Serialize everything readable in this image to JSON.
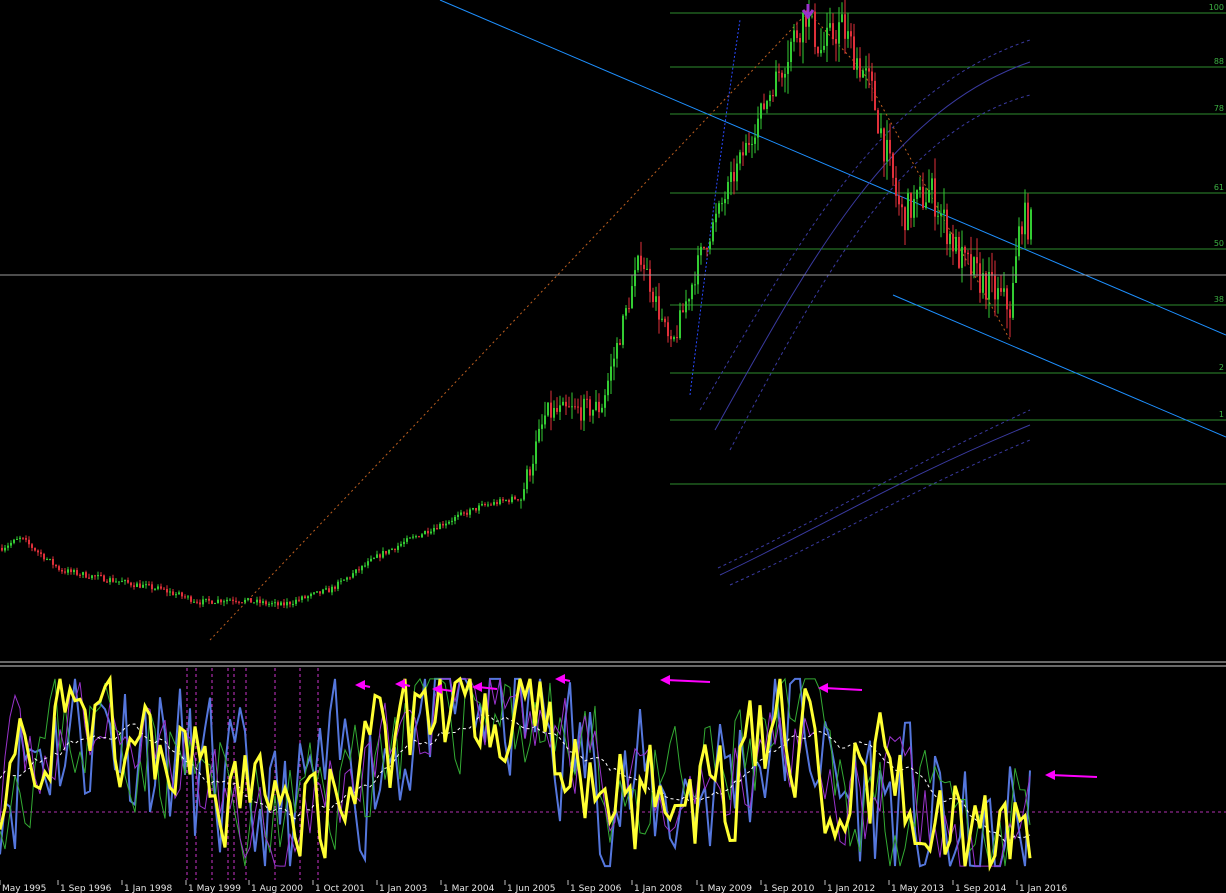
{
  "chart_data": {
    "type": "candlestick",
    "colors": {
      "background": "#000000",
      "bull": "#33cc33",
      "bear": "#e0303a",
      "fib": "#2e8b2e",
      "fib_label": "#3cb043",
      "trendline": "#1e90ff",
      "envelope": "#3a3aa0",
      "zigzag": "#c06020",
      "osc_main": "#ffff33",
      "osc_blue": "#5577dd",
      "osc_green": "#33aa33",
      "osc_purple": "#9933cc",
      "osc_signal": "#ffffff",
      "arrow": "#ff00ff",
      "date_text": "#e6e6e6"
    },
    "fib_levels": [
      "100",
      "88",
      "78",
      "61",
      "50",
      "38",
      "2",
      "1"
    ],
    "x_labels": [
      "May 1995",
      "1 Sep 1996",
      "1 Jan 1998",
      "1 May 1999",
      "1 Aug 2000",
      "1 Oct 2001",
      "1 Jan 2003",
      "1 Mar 2004",
      "1 Jun 2005",
      "1 Sep 2006",
      "1 Jan 2008",
      "1 May 2009",
      "1 Sep 2010",
      "1 Jan 2012",
      "1 May 2013",
      "1 Sep 2014",
      "1 Jan 2016"
    ],
    "price_keypoints": [
      [
        0,
        0.16
      ],
      [
        20,
        0.175
      ],
      [
        60,
        0.125
      ],
      [
        110,
        0.11
      ],
      [
        160,
        0.095
      ],
      [
        200,
        0.075
      ],
      [
        230,
        0.08
      ],
      [
        280,
        0.07
      ],
      [
        330,
        0.095
      ],
      [
        380,
        0.15
      ],
      [
        430,
        0.19
      ],
      [
        480,
        0.225
      ],
      [
        520,
        0.24
      ],
      [
        545,
        0.37
      ],
      [
        600,
        0.38
      ],
      [
        640,
        0.62
      ],
      [
        670,
        0.47
      ],
      [
        700,
        0.62
      ],
      [
        740,
        0.77
      ],
      [
        790,
        0.95
      ],
      [
        805,
        1.0
      ],
      [
        820,
        0.94
      ],
      [
        840,
        0.98
      ],
      [
        870,
        0.88
      ],
      [
        900,
        0.68
      ],
      [
        930,
        0.72
      ],
      [
        960,
        0.61
      ],
      [
        990,
        0.565
      ],
      [
        1010,
        0.535
      ],
      [
        1020,
        0.68
      ],
      [
        1030,
        0.665
      ]
    ],
    "oscillator_note": "yellow main oscillator with blue, green, purple companion lines and a white dashed signal line"
  }
}
